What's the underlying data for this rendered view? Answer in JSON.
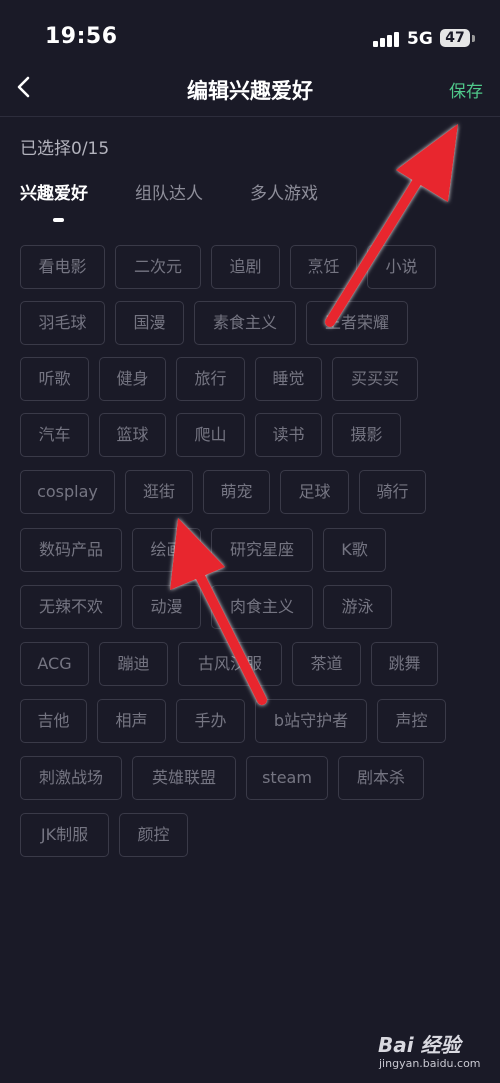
{
  "status": {
    "time": "19:56",
    "network": "5G",
    "battery": "47"
  },
  "nav": {
    "title": "编辑兴趣爱好",
    "save": "保存"
  },
  "selection": {
    "count_text": "已选择0/15"
  },
  "tabs": [
    {
      "label": "兴趣爱好",
      "active": true
    },
    {
      "label": "组队达人",
      "active": false
    },
    {
      "label": "多人游戏",
      "active": false
    }
  ],
  "tags": [
    "看电影",
    "二次元",
    "追剧",
    "烹饪",
    "小说",
    "羽毛球",
    "国漫",
    "素食主义",
    "王者荣耀",
    "听歌",
    "健身",
    "旅行",
    "睡觉",
    "买买买",
    "汽车",
    "篮球",
    "爬山",
    "读书",
    "摄影",
    "cosplay",
    "逛街",
    "萌宠",
    "足球",
    "骑行",
    "数码产品",
    "绘画",
    "研究星座",
    "K歌",
    "无辣不欢",
    "动漫",
    "肉食主义",
    "游泳",
    "ACG",
    "蹦迪",
    "古风汉服",
    "茶道",
    "跳舞",
    "吉他",
    "相声",
    "手办",
    "b站守护者",
    "声控",
    "刺激战场",
    "英雄联盟",
    "steam",
    "剧本杀",
    "JK制服",
    "颜控"
  ],
  "watermark": {
    "logo": "Bai 经验",
    "url": "jingyan.baidu.com"
  },
  "colors": {
    "background": "#1a1a27",
    "accent": "#4fc88a",
    "arrow": "#e8252e",
    "tag_border": "#3a3a48",
    "tag_text": "#757582"
  }
}
